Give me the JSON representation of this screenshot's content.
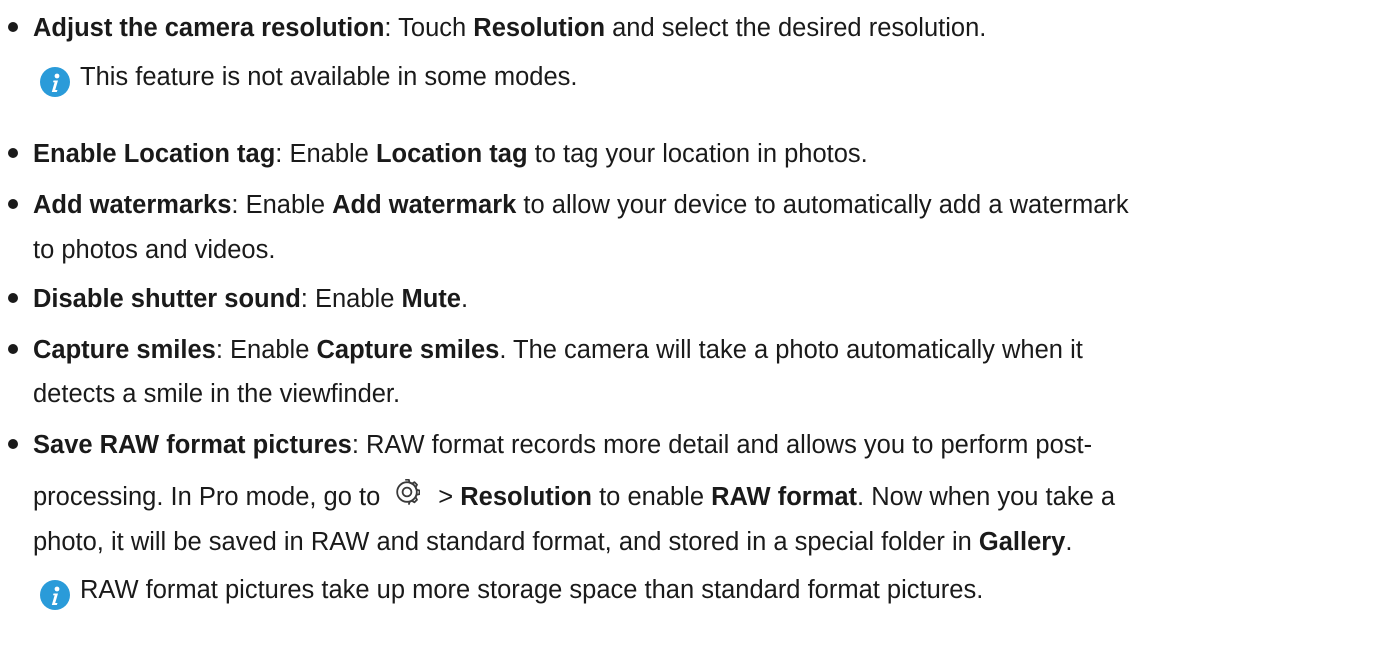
{
  "items": [
    {
      "title": "Adjust the camera resolution",
      "sep": ": ",
      "t1": "Touch ",
      "b1": "Resolution",
      "t2": " and select the desired resolution.",
      "note": "This feature is not available in some modes."
    },
    {
      "title": "Enable Location tag",
      "sep": ": ",
      "t1": "Enable ",
      "b1": "Location tag",
      "t2": " to tag your location in photos."
    },
    {
      "title": "Add watermarks",
      "sep": ": ",
      "t1": "Enable ",
      "b1": "Add watermark",
      "t2": " to allow your device to automatically add a watermark",
      "t3": "to photos and videos."
    },
    {
      "title": "Disable shutter sound",
      "sep": ": ",
      "t1": "Enable ",
      "b1": "Mute",
      "t2": "."
    },
    {
      "title": "Capture smiles",
      "sep": ": ",
      "t1": "Enable ",
      "b1": "Capture smiles",
      "t2": ". The camera will take a photo automatically when it",
      "t3": "detects a smile in the viewfinder."
    },
    {
      "title": "Save RAW format pictures",
      "sep": ": ",
      "t1": "RAW format records more detail and allows you to perform post-",
      "l2a": "processing. In Pro mode, go to",
      "l2b": "> ",
      "l2c": "Resolution",
      "l2d": " to enable ",
      "l2e": "RAW format",
      "l2f": ". Now when you take a",
      "l3a": "photo, it will be saved in RAW and standard format, and stored in a special folder in ",
      "l3b": "Gallery",
      "l3c": ".",
      "note": "RAW format pictures take up more storage space than standard format pictures."
    }
  ],
  "icons": {
    "info": "info-icon",
    "gear": "gear-icon",
    "accent": "#2a9bd9"
  }
}
